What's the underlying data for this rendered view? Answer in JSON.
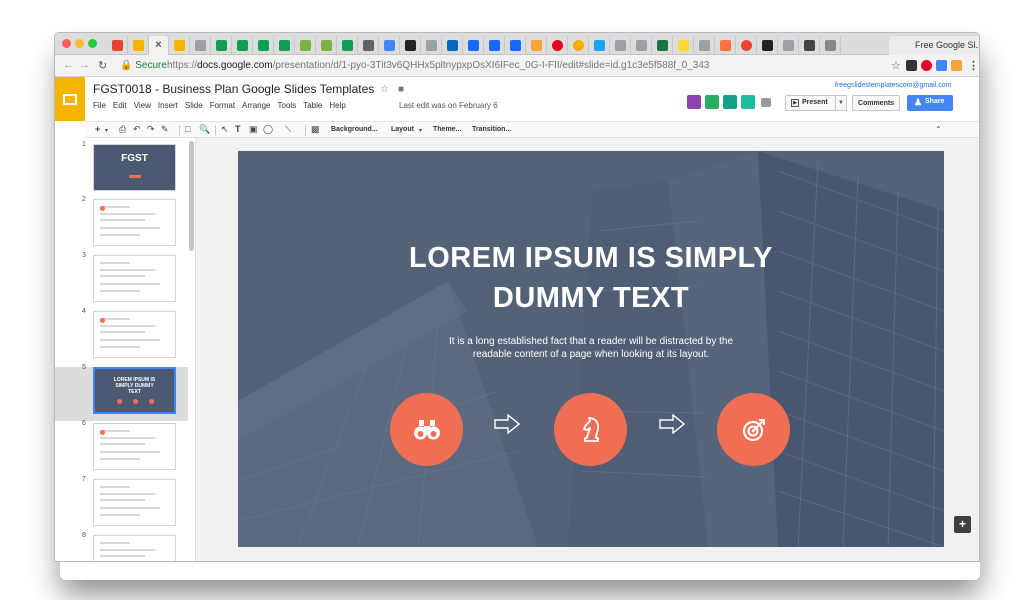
{
  "browser": {
    "last_tab_label": "Free Google Sl...",
    "secure_label": "Secure",
    "url_scheme": "https://",
    "url_host": "docs.google.com",
    "url_path": "/presentation/d/1-pyo-3Tit3v6QHHx5pltnypxpOsXI6IFec_0G-I-FII/edit#slide=id.g1c3e5f588f_0_343",
    "tab_favicons": [
      "gmail-icon",
      "bookmark-icon",
      "close-icon",
      "folder-icon",
      "doc-icon",
      "drive-icon",
      "sheets-icon",
      "sheets-icon",
      "sheets-icon",
      "tag-icon",
      "tag-icon",
      "sheets-icon",
      "download-icon",
      "translate-icon",
      "notion-icon",
      "doc-icon",
      "linkedin-icon",
      "behance-icon",
      "behance-icon",
      "behance-icon",
      "chart-icon",
      "pinterest-icon",
      "coin-icon",
      "twitter-icon",
      "doc-icon",
      "doc-icon",
      "excel-icon",
      "note-icon",
      "doc-icon",
      "tools-icon",
      "google-icon",
      "notion-icon",
      "doc-icon",
      "typography-icon",
      "ne-icon"
    ]
  },
  "app": {
    "doc_title": "FGST0018 - Business Plan Google Slides Templates",
    "menus": [
      "File",
      "Edit",
      "View",
      "Insert",
      "Slide",
      "Format",
      "Arrange",
      "Tools",
      "Table",
      "Help"
    ],
    "last_edit": "Last edit was on February 6",
    "account_email": "freegslidestemplatescom@gmail.com",
    "present_label": "Present",
    "comments_label": "Comments",
    "share_label": "Share"
  },
  "toolbar": {
    "background_label": "Background...",
    "layout_label": "Layout",
    "theme_label": "Theme...",
    "transition_label": "Transition..."
  },
  "filmstrip": {
    "slide_numbers": [
      "1",
      "2",
      "3",
      "4",
      "5",
      "6",
      "7",
      "8"
    ],
    "selected_slide": "5",
    "thumb1_title": "FGST",
    "thumb5_title": "LOREM IPSUM IS SIMPLY DUMMY TEXT"
  },
  "slide": {
    "title_line1": "LOREM IPSUM IS SIMPLY",
    "title_line2": "DUMMY TEXT",
    "subtitle_line1": "It is a long established fact that a reader will be distracted by the",
    "subtitle_line2": "readable content of a page when looking at its layout.",
    "icons": [
      "binoculars-icon",
      "chess-knight-icon",
      "target-icon"
    ],
    "accent_color": "#f06e54",
    "background_color": "#546278"
  }
}
